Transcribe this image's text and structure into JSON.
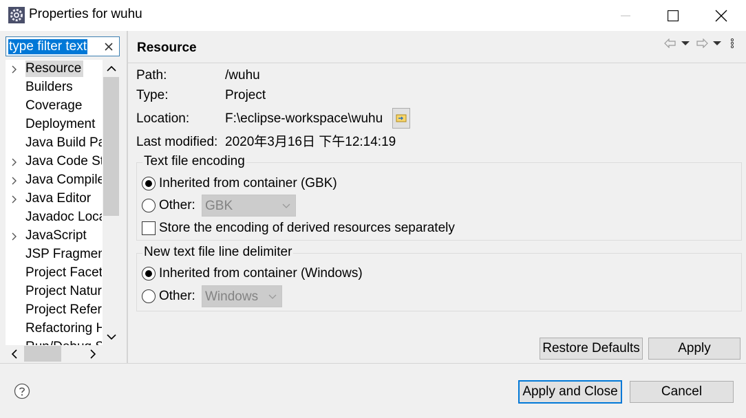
{
  "window": {
    "title": "Properties for wuhu"
  },
  "icons": {
    "app": "eclipse-gear-icon",
    "minimize": "minimize-icon",
    "maximize": "maximize-icon",
    "close": "close-icon",
    "clear_filter": "clear-icon",
    "back": "back-arrow-icon",
    "forward": "forward-arrow-icon",
    "menu": "view-menu-icon",
    "browse": "open-location-icon",
    "help": "help-icon"
  },
  "filter": {
    "value": "type filter text"
  },
  "tree": {
    "items": [
      {
        "label": "Resource",
        "expandable": true,
        "selected": true
      },
      {
        "label": "Builders",
        "expandable": false
      },
      {
        "label": "Coverage",
        "expandable": false
      },
      {
        "label": "Deployment",
        "expandable": false
      },
      {
        "label": "Java Build Pa",
        "expandable": false
      },
      {
        "label": "Java Code Sty",
        "expandable": true
      },
      {
        "label": "Java Compile",
        "expandable": true
      },
      {
        "label": "Java Editor",
        "expandable": true
      },
      {
        "label": "Javadoc Loca",
        "expandable": false
      },
      {
        "label": "JavaScript",
        "expandable": true
      },
      {
        "label": "JSP Fragmen",
        "expandable": false
      },
      {
        "label": "Project Facet",
        "expandable": false
      },
      {
        "label": "Project Natur",
        "expandable": false
      },
      {
        "label": "Project Refer",
        "expandable": false
      },
      {
        "label": "Refactoring H",
        "expandable": false
      },
      {
        "label": "Run/Debug S",
        "expandable": false
      }
    ]
  },
  "page": {
    "title": "Resource",
    "path_label": "Path:",
    "path_value": "/wuhu",
    "type_label": "Type:",
    "type_value": "Project",
    "location_label": "Location:",
    "location_value": "F:\\eclipse-workspace\\wuhu",
    "modified_label": "Last modified:",
    "modified_value": "2020年3月16日 下午12:14:19"
  },
  "encoding": {
    "group_title": "Text file encoding",
    "inherited_label": "Inherited from container (GBK)",
    "inherited_checked": true,
    "other_label": "Other:",
    "other_value": "GBK",
    "store_label": "Store the encoding of derived resources separately",
    "store_checked": false
  },
  "delimiter": {
    "group_title": "New text file line delimiter",
    "inherited_label": "Inherited from container (Windows)",
    "inherited_checked": true,
    "other_label": "Other:",
    "other_value": "Windows"
  },
  "buttons": {
    "restore_defaults": "Restore Defaults",
    "apply": "Apply",
    "apply_and_close": "Apply and Close",
    "cancel": "Cancel"
  },
  "colors": {
    "selection": "#0078d7",
    "tree_selected": "#d9d9d9",
    "background": "#f0f0f0"
  }
}
